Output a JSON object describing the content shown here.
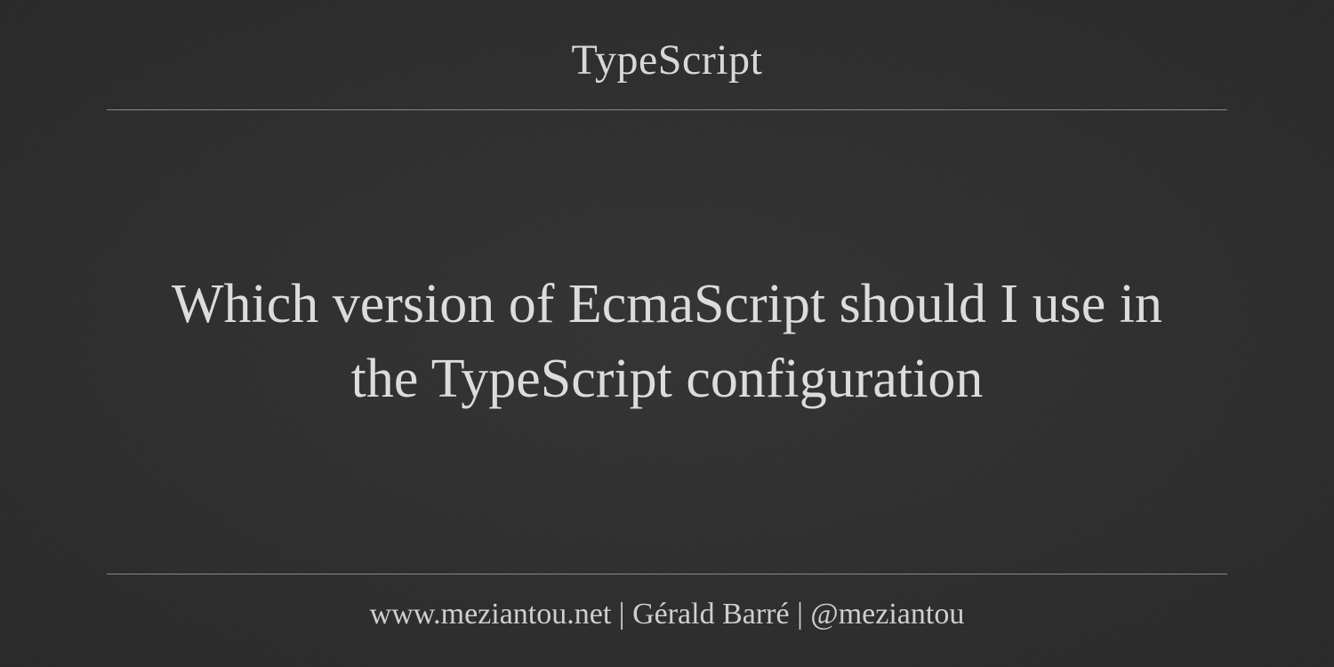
{
  "header": {
    "category": "TypeScript"
  },
  "main": {
    "title": "Which version of EcmaScript should I use in the TypeScript configuration"
  },
  "footer": {
    "text": "www.meziantou.net | Gérald Barré | @meziantou"
  }
}
